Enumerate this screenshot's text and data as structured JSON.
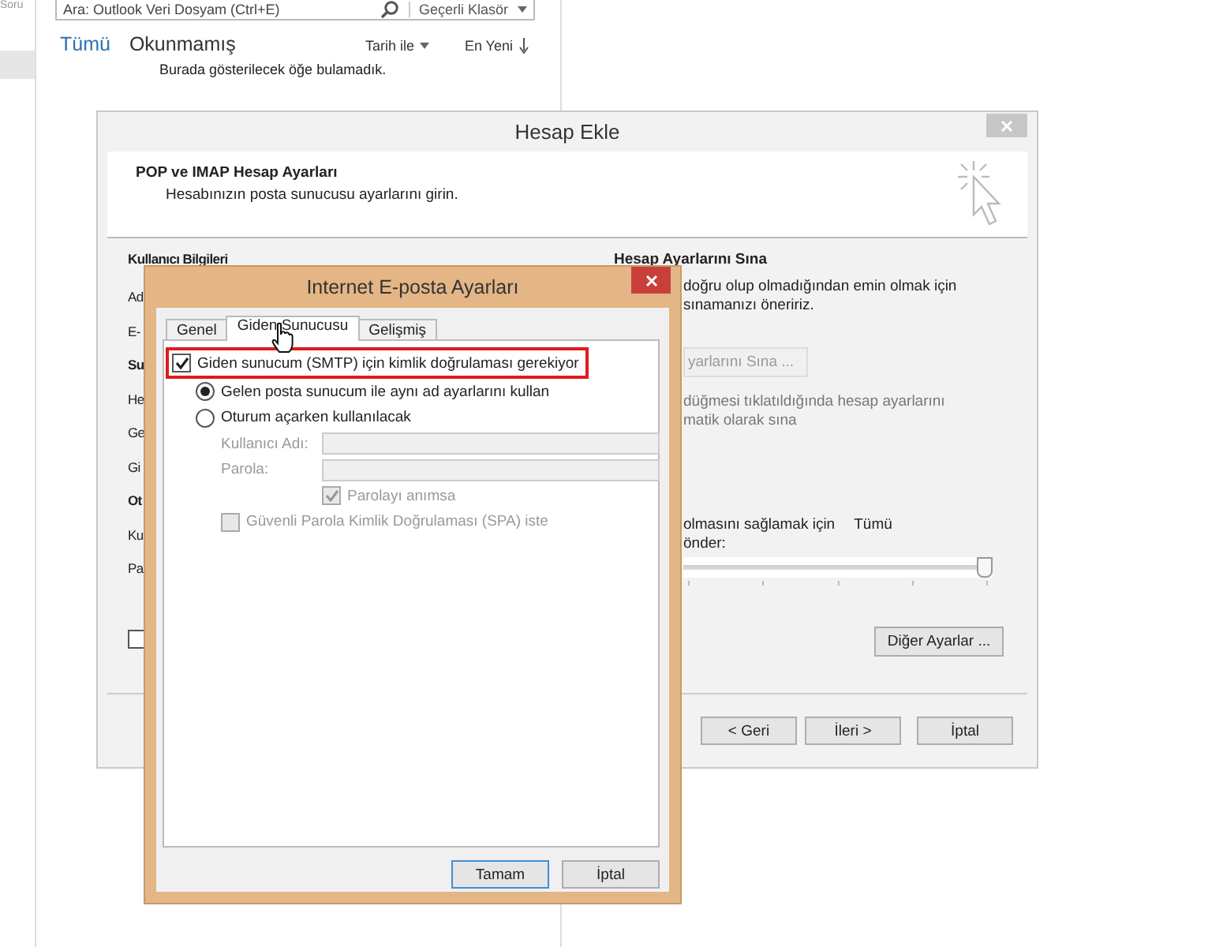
{
  "outlook": {
    "sidebar_label": "Soru",
    "search": {
      "placeholder": "Ara: Outlook Veri Dosyam (Ctrl+E)"
    },
    "scope": "Geçerli Klasör",
    "filters": [
      {
        "label": "Tümü",
        "selected": true
      },
      {
        "label": "Okunmamış",
        "selected": false
      }
    ],
    "sort": "Tarih ile",
    "order": "En Yeni",
    "empty_message": "Burada gösterilecek öğe bulamadık."
  },
  "account_dialog": {
    "title": "Hesap Ekle",
    "heading": "POP ve IMAP Hesap Ayarları",
    "subheading": "Hesabınızın posta sunucusu ayarlarını girin.",
    "left_items": [
      {
        "kind": "heading",
        "text": "Kullanıcı Bilgileri"
      },
      {
        "kind": "label",
        "text": "Ad"
      },
      {
        "kind": "label",
        "text": "E-"
      },
      {
        "kind": "heading",
        "text": "Su"
      },
      {
        "kind": "label",
        "text": "He"
      },
      {
        "kind": "label",
        "text": "Ge"
      },
      {
        "kind": "label",
        "text": "Gi"
      },
      {
        "kind": "heading",
        "text": "Ot"
      },
      {
        "kind": "label",
        "text": "Ku"
      },
      {
        "kind": "label",
        "text": "Pa"
      }
    ],
    "left_checkbox": {
      "checked": false
    },
    "test_heading": "Hesap Ayarlarını Sına",
    "test_lines": [
      "doğru olup olmadığından emin olmak için",
      "sınamanızı öneririz."
    ],
    "test_button": {
      "label": "yarlarını Sına ...",
      "disabled": true
    },
    "auto_lines": [
      "düğmesi tıklatıldığında hesap ayarlarını",
      "matik olarak sına"
    ],
    "slider_lines": [
      "olmasını sağlamak için",
      "önder:"
    ],
    "slider_value": "Tümü",
    "slider": {
      "level": 1.0
    },
    "more_button": "Diğer Ayarlar ...",
    "buttons": [
      "< Geri",
      "İleri >",
      "İptal"
    ]
  },
  "email_settings_dialog": {
    "title": "Internet E-posta Ayarları",
    "tabs": [
      {
        "label": "Genel",
        "selected": false
      },
      {
        "label": "Giden Sunucusu",
        "selected": true
      },
      {
        "label": "Gelişmiş",
        "selected": false
      }
    ],
    "options": [
      {
        "kind": "checkbox",
        "label": "Giden sunucum (SMTP) için kimlik doğrulaması gerekiyor",
        "checked": true,
        "disabled": false,
        "highlighted": true,
        "children": [
          {
            "kind": "radio",
            "label": "Gelen posta sunucum ile aynı ad ayarlarını kullan",
            "selected": true,
            "disabled": false
          },
          {
            "kind": "radio",
            "label": "Oturum açarken kullanılacak",
            "selected": false,
            "disabled": false,
            "children": [
              {
                "kind": "field",
                "label": "Kullanıcı Adı:",
                "disabled": true
              },
              {
                "kind": "field",
                "label": "Parola:",
                "disabled": true,
                "children": [
                  {
                    "kind": "checkbox",
                    "label": "Parolayı anımsa",
                    "checked": true,
                    "disabled": true
                  }
                ]
              },
              {
                "kind": "checkbox",
                "label": "Güvenli Parola Kimlik Doğrulaması (SPA) iste",
                "checked": false,
                "disabled": true
              }
            ]
          }
        ]
      }
    ],
    "buttons": [
      {
        "label": "Tamam",
        "default": true
      },
      {
        "label": "İptal",
        "default": false
      }
    ]
  }
}
